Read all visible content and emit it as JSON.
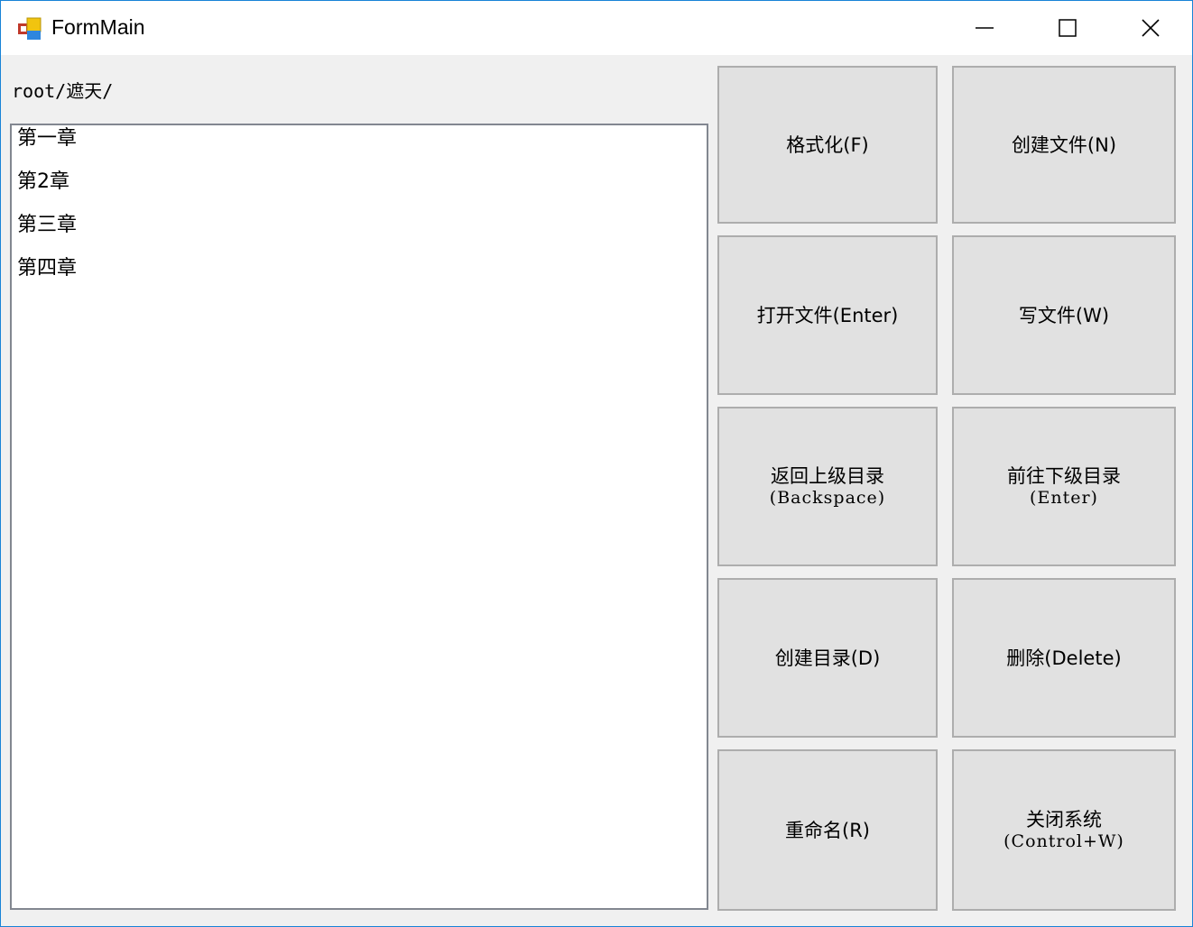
{
  "window": {
    "title": "FormMain"
  },
  "path": "root/遮天/",
  "files": [
    "第一章",
    "第2章",
    "第三章",
    "第四章"
  ],
  "buttons": {
    "format": {
      "label": "格式化(F)"
    },
    "create_file": {
      "label": "创建文件(N)"
    },
    "open_file": {
      "label": "打开文件(Enter)"
    },
    "write_file": {
      "label": "写文件(W)"
    },
    "go_up": {
      "label": "返回上级目录",
      "sub": "(Backspace)"
    },
    "go_down": {
      "label": "前往下级目录",
      "sub": "(Enter)"
    },
    "create_dir": {
      "label": "创建目录(D)"
    },
    "delete": {
      "label": "删除(Delete)"
    },
    "rename": {
      "label": "重命名(R)"
    },
    "shutdown": {
      "label": "关闭系统",
      "sub": "(Control+W)"
    }
  }
}
